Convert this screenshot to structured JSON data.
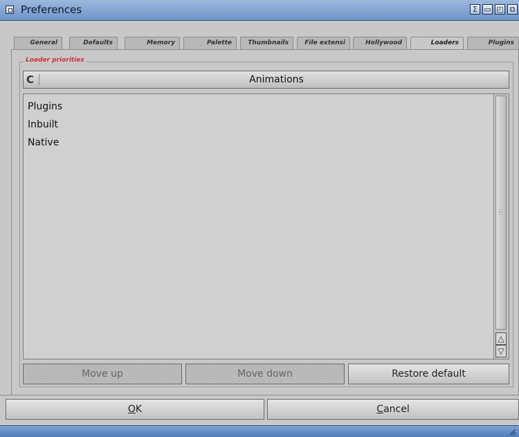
{
  "window": {
    "title": "Preferences"
  },
  "tabs": [
    {
      "label": "General"
    },
    {
      "label": "Defaults"
    },
    {
      "label": "Memory"
    },
    {
      "label": "Palette"
    },
    {
      "label": "Thumbnails"
    },
    {
      "label": "File extensi"
    },
    {
      "label": "Hollywood"
    },
    {
      "label": "Loaders",
      "active": true
    },
    {
      "label": "Plugins"
    }
  ],
  "group": {
    "label": "Loader priorities"
  },
  "cycle": {
    "value": "Animations"
  },
  "list": {
    "items": [
      "Plugins",
      "Inbuilt",
      "Native"
    ]
  },
  "buttons": {
    "move_up": "Move up",
    "move_down": "Move down",
    "restore_default": "Restore default",
    "ok_key": "O",
    "ok_rest": "K",
    "cancel_key": "C",
    "cancel_rest": "ancel"
  },
  "colors": {
    "legend": "#d2303c",
    "titlebar": "#7fa1d0"
  }
}
